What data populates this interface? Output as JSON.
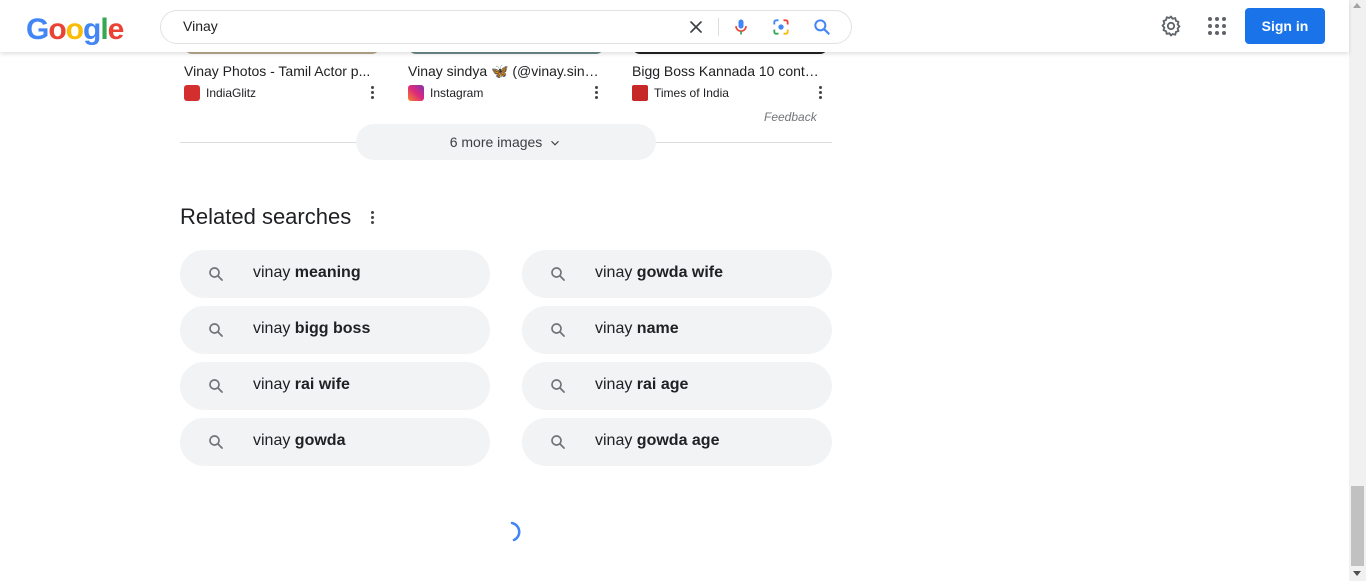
{
  "header": {
    "logo_letters": [
      "G",
      "o",
      "o",
      "g",
      "l",
      "e"
    ],
    "logo_colors": [
      "#4285F4",
      "#EA4335",
      "#FBBC05",
      "#4285F4",
      "#34A853",
      "#EA4335"
    ],
    "search_value": "Vinay",
    "signin_label": "Sign in",
    "icons": [
      "clear-icon",
      "microphone-icon",
      "lens-icon",
      "search-icon",
      "settings-icon",
      "apps-icon"
    ]
  },
  "images": [
    {
      "title": "Vinay Photos - Tamil Actor p...",
      "source": "IndiaGlitz",
      "source_icon_color": "#d32f2f",
      "thumb_color": "#b9a98c"
    },
    {
      "title": "Vinay sindya 🦋 (@vinay.sind...",
      "source": "Instagram",
      "source_icon_color": "#d6249f",
      "thumb_color": "#6c8b88"
    },
    {
      "title": "Bigg Boss Kannada 10 conte...",
      "source": "Times of India",
      "source_icon_color": "#d32f2f",
      "thumb_color": "#222222"
    }
  ],
  "feedback_label": "Feedback",
  "more_images_label": "6 more images",
  "related": {
    "title": "Related searches",
    "items": [
      {
        "prefix": "vinay ",
        "bold": "meaning"
      },
      {
        "prefix": "vinay ",
        "bold": "gowda wife"
      },
      {
        "prefix": "vinay ",
        "bold": "bigg boss"
      },
      {
        "prefix": "vinay ",
        "bold": "name"
      },
      {
        "prefix": "vinay ",
        "bold": "rai wife"
      },
      {
        "prefix": "vinay ",
        "bold": "rai age"
      },
      {
        "prefix": "vinay ",
        "bold": "gowda"
      },
      {
        "prefix": "vinay ",
        "bold": "gowda age"
      }
    ]
  },
  "colors": {
    "accent": "#1a73e8",
    "chip_bg": "#f1f3f4"
  }
}
